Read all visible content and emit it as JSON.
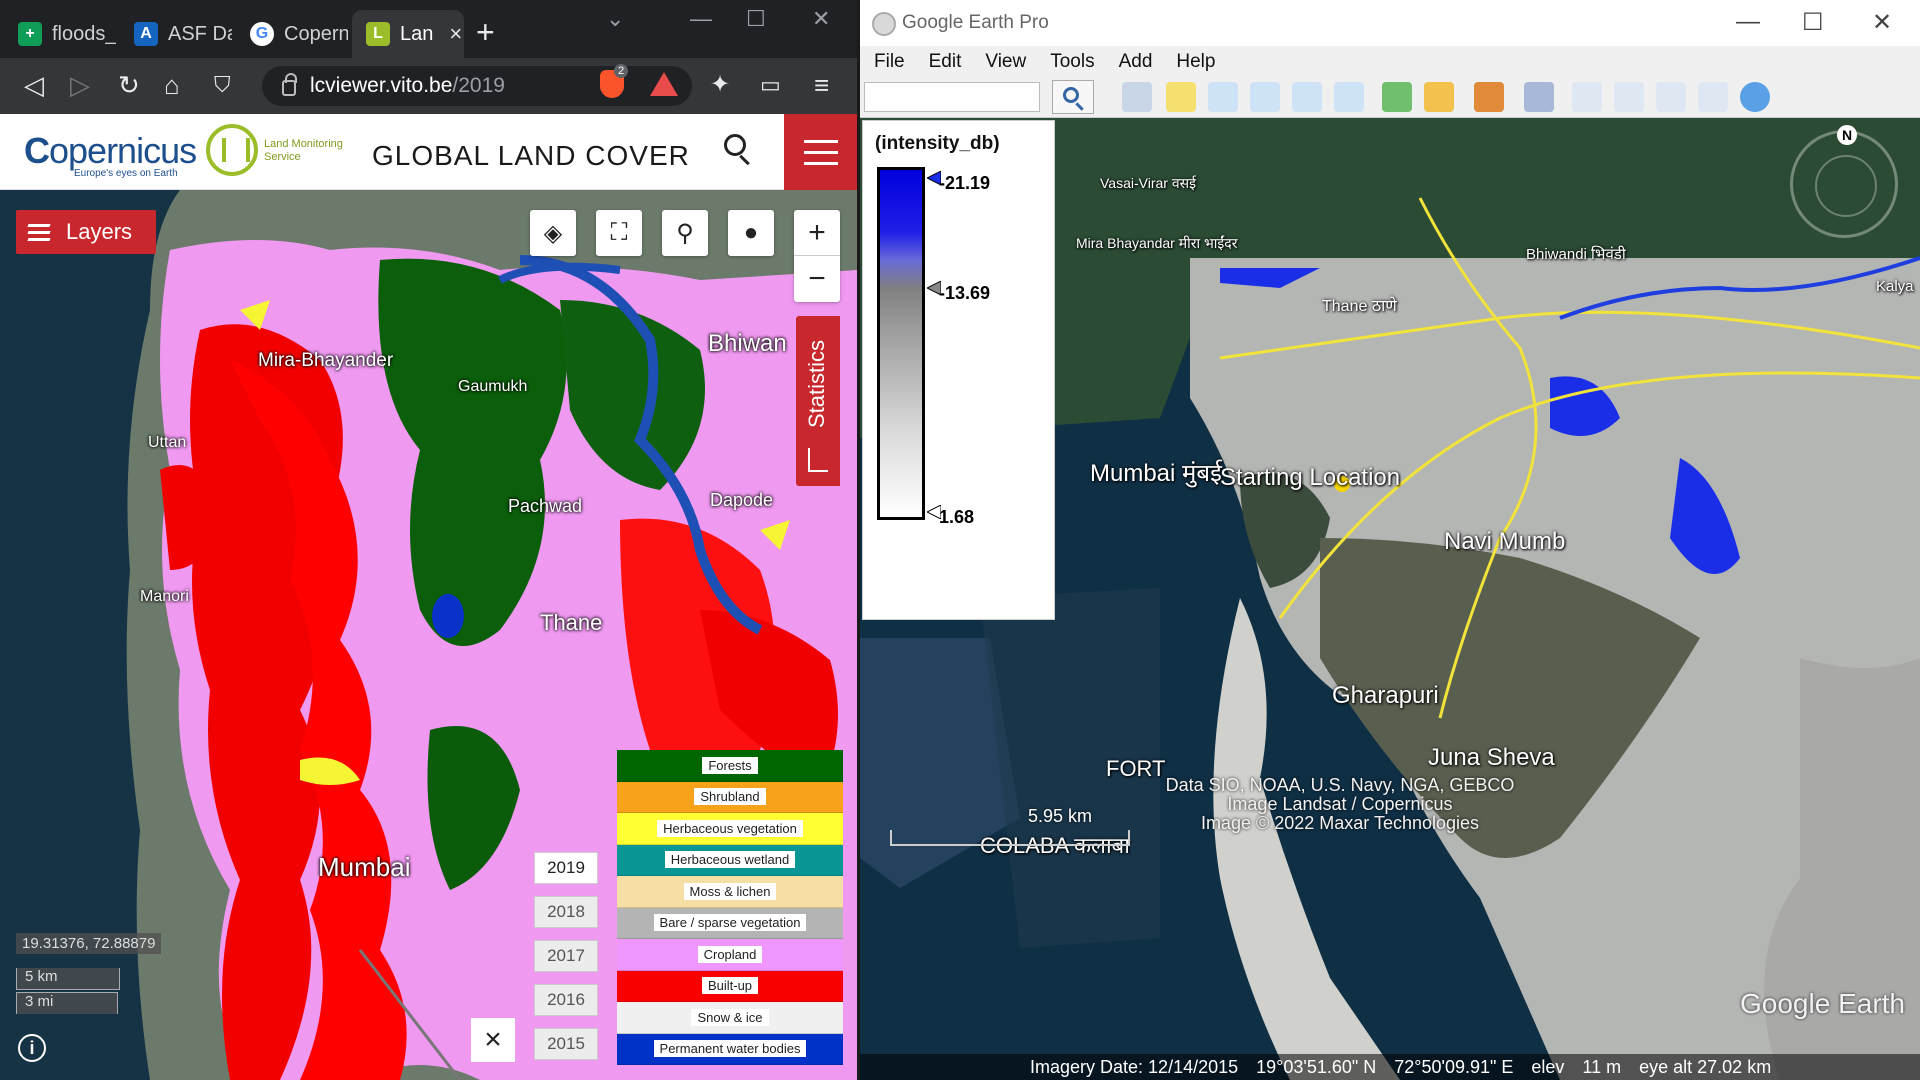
{
  "browser": {
    "tabs": [
      {
        "label": "floods_",
        "favicon_color": "#0f9d58",
        "favicon_glyph": "+"
      },
      {
        "label": "ASF Da",
        "favicon_color": "#1565c0",
        "favicon_glyph": "A"
      },
      {
        "label": "Copern",
        "favicon_color": "#ffffff",
        "favicon_glyph": "G"
      },
      {
        "label": "Lan",
        "favicon_color": "#9cbd2a",
        "favicon_glyph": "L"
      }
    ],
    "new_tab_glyph": "+",
    "url_host": "lcviewer.vito.be",
    "url_path": "/2019",
    "brave_shield_count": "2"
  },
  "site": {
    "title": "GLOBAL LAND COVER",
    "copernicus_word": "opernicus",
    "copernicus_c": "C",
    "copernicus_tagline": "Europe's eyes on Earth",
    "lms_line1": "Land Monitoring",
    "lms_line2": "Service"
  },
  "map": {
    "layers_label": "Layers",
    "statistics_label": "Statistics",
    "zoom_in": "+",
    "zoom_out": "−",
    "place_labels": {
      "mira": "Mira-Bhayander",
      "gaumukh": "Gaumukh",
      "uttan": "Uttan",
      "pachwad": "Pachwad",
      "dapode": "Dapode",
      "manori": "Manori",
      "thane": "Thane",
      "bhiwandi": "Bhiwan",
      "mumbai": "Mumbai"
    },
    "legend": [
      {
        "label": "Forests",
        "color": "#006600"
      },
      {
        "label": "Shrubland",
        "color": "#f7a21b"
      },
      {
        "label": "Herbaceous vegetation",
        "color": "#ffff33"
      },
      {
        "label": "Herbaceous wetland",
        "color": "#0b9696"
      },
      {
        "label": "Moss & lichen",
        "color": "#f5dfa5"
      },
      {
        "label": "Bare / sparse vegetation",
        "color": "#b4b4b4"
      },
      {
        "label": "Cropland",
        "color": "#f096ff"
      },
      {
        "label": "Built-up",
        "color": "#fa0000"
      },
      {
        "label": "Snow & ice",
        "color": "#f0f0f0"
      },
      {
        "label": "Permanent water bodies",
        "color": "#0032c8"
      }
    ],
    "years": [
      "2019",
      "2018",
      "2017",
      "2016",
      "2015"
    ],
    "active_year": "2019",
    "close_glyph": "×",
    "coordinates": "19.31376, 72.88879",
    "scale_km": "5 km",
    "scale_mi": "3 mi",
    "info_glyph": "i"
  },
  "earth": {
    "title": "Google Earth Pro",
    "menu": [
      "File",
      "Edit",
      "View",
      "Tools",
      "Add",
      "Help"
    ],
    "colorbar": {
      "title": "(intensity_db)",
      "max_label": "-21.19",
      "mid_label": "-13.69",
      "min_label": "1.68"
    },
    "labels": {
      "vasai": "Vasai-Virar वसई",
      "mira": "Mira Bhayandar मीरा भाईंदर",
      "bhiwandi": "Bhiwandi भिवंडी",
      "kalyan": "Kalya",
      "thane": "Thane ठाणे",
      "mumbai": "Mumbai मुंबई",
      "starting": "Starting Location",
      "navi": "Navi Mumb",
      "gharapuri": "Gharapuri",
      "juna": "Juna Sheva",
      "fort": "FORT",
      "colaba": "COLABA कलाबा"
    },
    "credits": [
      "Data SIO, NOAA, U.S. Navy, NGA, GEBCO",
      "Image Landsat / Copernicus",
      "Image © 2022 Maxar Technologies"
    ],
    "scale_label": "5.95 km",
    "status": {
      "imagery_date": "Imagery Date: 12/14/2015",
      "lat": "19°03'51.60\" N",
      "lon": "72°50'09.91\" E",
      "elev": "elev",
      "elev_value": "11 m",
      "eye_alt": "eye alt  27.02 km"
    },
    "watermark": "Google Earth",
    "compass_n": "N"
  }
}
